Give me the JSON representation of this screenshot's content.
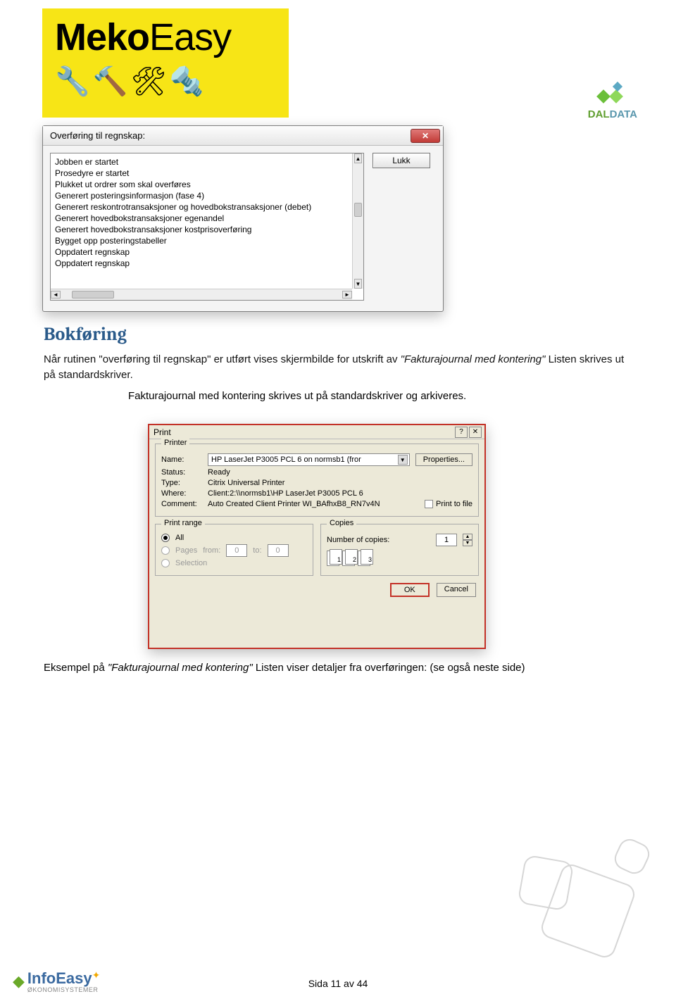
{
  "header": {
    "meko_bold": "Meko",
    "meko_light": "Easy",
    "daldata_green": "DAL",
    "daldata_blue": "DATA"
  },
  "dialog1": {
    "title": "Overføring til regnskap:",
    "close_button": "Lukk",
    "log": [
      "Jobben er startet",
      "Prosedyre er startet",
      "Plukket ut ordrer som skal overføres",
      "Generert posteringsinformasjon (fase 4)",
      "Generert reskontrotransaksjoner og hovedbokstransaksjoner (debet)",
      "Generert hovedbokstransaksjoner egenandel",
      "Generert hovedbokstransaksjoner kostprisoverføring",
      "Bygget opp posteringstabeller",
      "Oppdatert regnskap",
      "Oppdatert regnskap"
    ]
  },
  "section_title": "Bokføring",
  "para1_a": "Når rutinen \"overføring til regnskap\" er utført vises skjermbilde for utskrift av ",
  "para1_b": "\"Fakturajournal med kontering\"",
  "para1_c": " Listen skrives ut på standardskriver.",
  "center_line": "Fakturajournal med kontering skrives ut på standardskriver og arkiveres.",
  "print": {
    "title": "Print",
    "group_printer": "Printer",
    "name_label": "Name:",
    "name_value": "HP LaserJet P3005 PCL 6 on normsb1 (fror",
    "properties": "Properties...",
    "status_label": "Status:",
    "status_value": "Ready",
    "type_label": "Type:",
    "type_value": "Citrix Universal Printer",
    "where_label": "Where:",
    "where_value": "Client:2:\\\\normsb1\\HP LaserJet P3005 PCL 6",
    "comment_label": "Comment:",
    "comment_value": "Auto Created Client Printer WI_BAfhxB8_RN7v4N",
    "print_to_file": "Print to file",
    "group_range": "Print range",
    "all": "All",
    "pages": "Pages",
    "from": "from:",
    "to": "to:",
    "from_val": "0",
    "to_val": "0",
    "selection": "Selection",
    "group_copies": "Copies",
    "num_copies_label": "Number of copies:",
    "num_copies_value": "1",
    "collate1": "1",
    "collate2": "2",
    "collate3": "3",
    "ok": "OK",
    "cancel": "Cancel"
  },
  "caption2_a": "Eksempel på ",
  "caption2_b": "\"Fakturajournal med kontering\"",
  "caption2_c": " Listen viser detaljer fra overføringen: (se også neste side)",
  "footer": {
    "brand": "InfoEasy",
    "sub": "ØKONOMISYSTEMER",
    "page": "Sida 11 av 44"
  }
}
